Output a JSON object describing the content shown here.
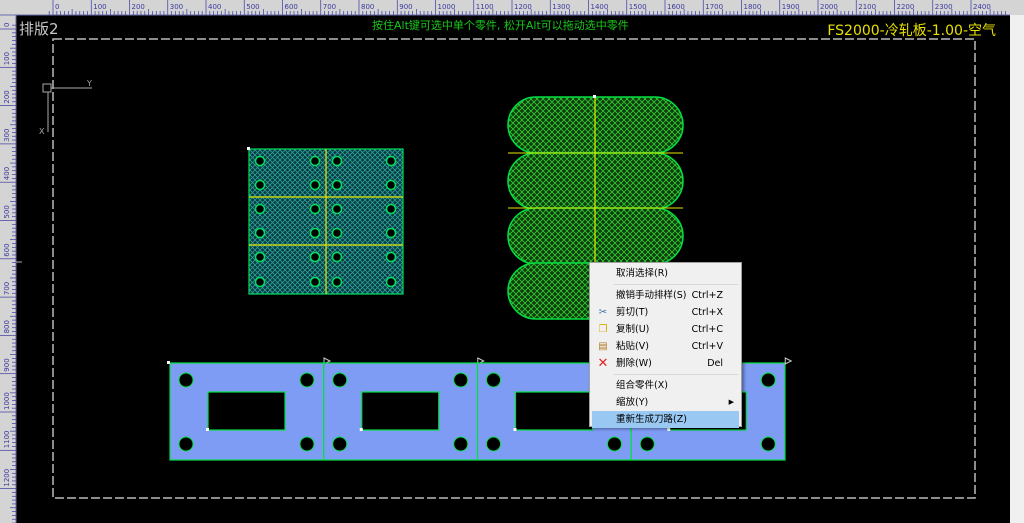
{
  "canvas": {
    "title": "排版2",
    "hint": "按住Alt键可选中单个零件, 松开Alt可以拖动选中零件",
    "material": "FS2000-冷轧板-1.00-空气",
    "axis_x": "X",
    "axis_y": "Y"
  },
  "ruler": {
    "top_labels": [
      "0",
      "100",
      "200",
      "300",
      "400",
      "500",
      "600",
      "700",
      "800",
      "900",
      "1000",
      "1100",
      "1200",
      "1300",
      "1400",
      "1500",
      "1600",
      "1700",
      "1800",
      "1900",
      "2000",
      "2100",
      "2200",
      "2300",
      "2400"
    ],
    "left_labels": [
      "0",
      "100",
      "200",
      "300",
      "400",
      "500",
      "600",
      "700",
      "800",
      "900",
      "1000",
      "1100",
      "1200"
    ]
  },
  "context_menu": {
    "items": [
      {
        "label": "取消选择(R)",
        "shortcut": "",
        "icon": ""
      },
      {
        "label": "撤销手动排样(S)",
        "shortcut": "Ctrl+Z",
        "icon": ""
      },
      {
        "label": "剪切(T)",
        "shortcut": "Ctrl+X",
        "icon": "scissors-icon"
      },
      {
        "label": "复制(U)",
        "shortcut": "Ctrl+C",
        "icon": "copy-icon"
      },
      {
        "label": "粘贴(V)",
        "shortcut": "Ctrl+V",
        "icon": "paste-icon"
      },
      {
        "label": "删除(W)",
        "shortcut": "Del",
        "icon": "delete-icon"
      },
      {
        "label": "组合零件(X)",
        "shortcut": "",
        "icon": ""
      },
      {
        "label": "缩放(Y)",
        "shortcut": "",
        "icon": ""
      },
      {
        "label": "重新生成刀路(Z)",
        "shortcut": "",
        "icon": ""
      }
    ]
  },
  "colors": {
    "background": "#000000",
    "plate": "#7f9cf5",
    "part_outline": "#00e040",
    "highlight": "#99c9f2",
    "selection": "#ffff00"
  }
}
